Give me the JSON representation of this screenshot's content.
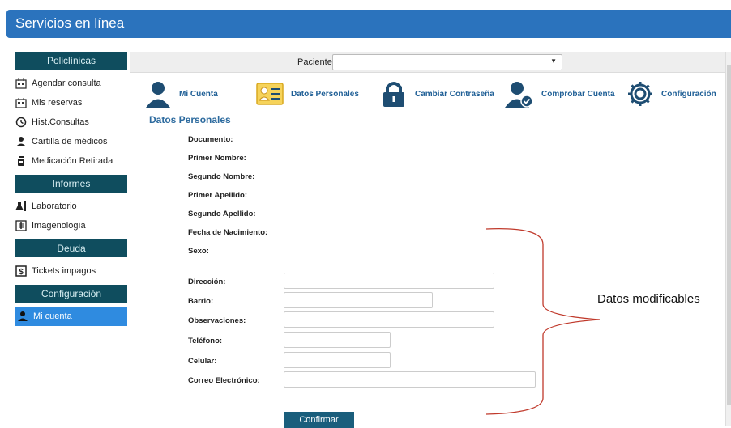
{
  "header": {
    "title": "Servicios en línea"
  },
  "sidebar": {
    "sections": [
      {
        "title": "Policlínicas",
        "items": [
          {
            "label": "Agendar consulta",
            "icon": "calendar-icon"
          },
          {
            "label": "Mis reservas",
            "icon": "calendar-icon"
          },
          {
            "label": "Hist.Consultas",
            "icon": "history-icon"
          },
          {
            "label": "Cartilla de médicos",
            "icon": "doctor-icon"
          },
          {
            "label": "Medicación Retirada",
            "icon": "medicine-bottle-icon"
          }
        ]
      },
      {
        "title": "Informes",
        "items": [
          {
            "label": "Laboratorio",
            "icon": "lab-flask-icon"
          },
          {
            "label": "Imagenología",
            "icon": "xray-icon"
          }
        ]
      },
      {
        "title": "Deuda",
        "items": [
          {
            "label": "Tickets impagos",
            "icon": "dollar-ticket-icon"
          }
        ]
      },
      {
        "title": "Configuración",
        "items": [
          {
            "label": "Mi cuenta",
            "icon": "user-icon",
            "active": true
          }
        ]
      }
    ]
  },
  "topbar": {
    "paciente_label": "Paciente",
    "paciente_value": ""
  },
  "nav": [
    {
      "label": "Mi Cuenta",
      "icon": "user-icon"
    },
    {
      "label": "Datos Personales",
      "icon": "id-card-icon"
    },
    {
      "label": "Cambiar Contraseña",
      "icon": "lock-icon"
    },
    {
      "label": "Comprobar Cuenta",
      "icon": "user-check-icon"
    },
    {
      "label": "Configuración",
      "icon": "gear-icon"
    }
  ],
  "form": {
    "title": "Datos Personales",
    "readonly_fields": [
      "Documento:",
      "Primer Nombre:",
      "Segundo Nombre:",
      "Primer Apellido:",
      "Segundo Apellido:",
      "Fecha de Nacimiento:",
      "Sexo:"
    ],
    "editable_fields": [
      "Dirección:",
      "Barrio:",
      "Observaciones:",
      "Teléfono:",
      "Celular:",
      "Correo Electrónico:"
    ],
    "confirm_label": "Confirmar"
  },
  "annotation": {
    "text": "Datos modificables"
  },
  "colors": {
    "header": "#2b73bd",
    "sidebar_section": "#0f4d5e",
    "active": "#2f8be0",
    "nav_text": "#1f5f96",
    "confirm": "#1a5e7c",
    "bracket": "#c0392b"
  }
}
